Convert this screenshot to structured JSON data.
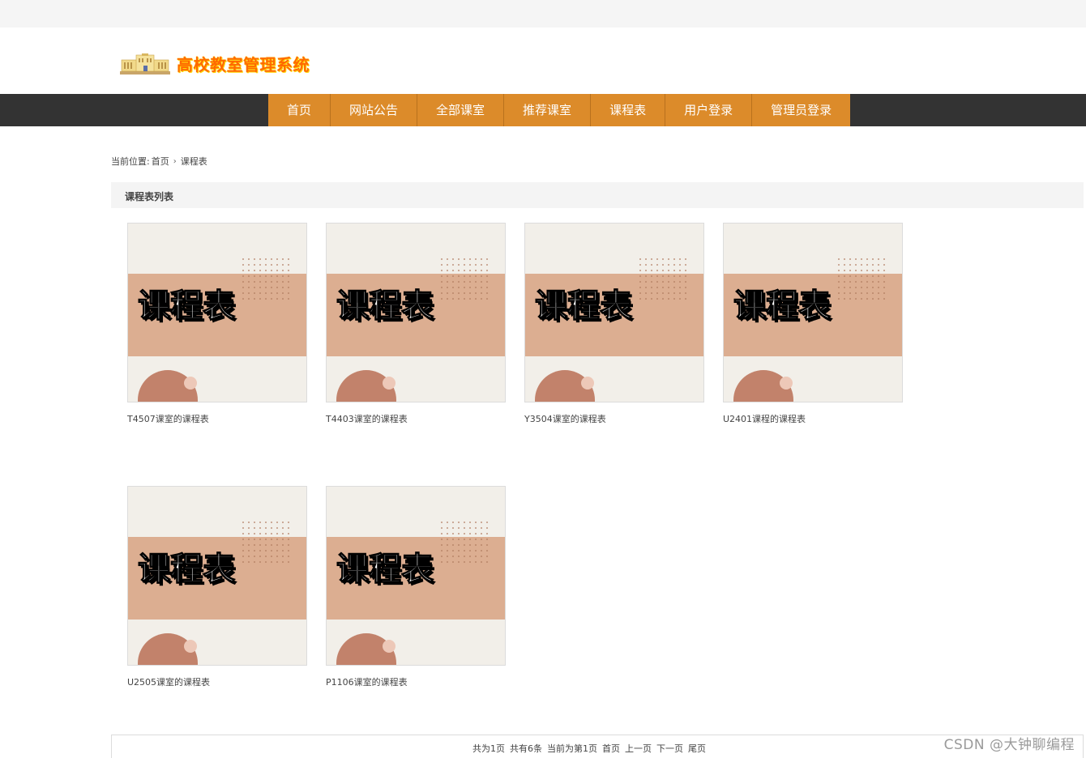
{
  "header": {
    "site_title": "高校教室管理系统",
    "logo_icon": "school-building-icon"
  },
  "nav": {
    "items": [
      {
        "label": "首页"
      },
      {
        "label": "网站公告"
      },
      {
        "label": "全部课室"
      },
      {
        "label": "推荐课室"
      },
      {
        "label": "课程表"
      },
      {
        "label": "用户登录"
      },
      {
        "label": "管理员登录"
      }
    ],
    "accent_color": "#dc8b2a",
    "bar_color": "#333333"
  },
  "breadcrumb": {
    "prefix": "当前位置:",
    "home": "首页",
    "current": "课程表",
    "separator_icon": "chevron-right-icon"
  },
  "section": {
    "title": "课程表列表"
  },
  "cards": {
    "thumbnail_text": "课程表",
    "items": [
      {
        "title": "T4507课室的课程表"
      },
      {
        "title": "T4403课室的课程表"
      },
      {
        "title": "Y3504课室的课程表"
      },
      {
        "title": "U2401课程的课程表"
      },
      {
        "title": "U2505课室的课程表"
      },
      {
        "title": "P1106课室的课程表"
      }
    ]
  },
  "pager": {
    "total_pages": "共为1页",
    "total_items": "共有6条",
    "current_page": "当前为第1页",
    "first": "首页",
    "prev": "上一页",
    "next": "下一页",
    "last": "尾页"
  },
  "watermark": "CSDN @大钟聊编程"
}
